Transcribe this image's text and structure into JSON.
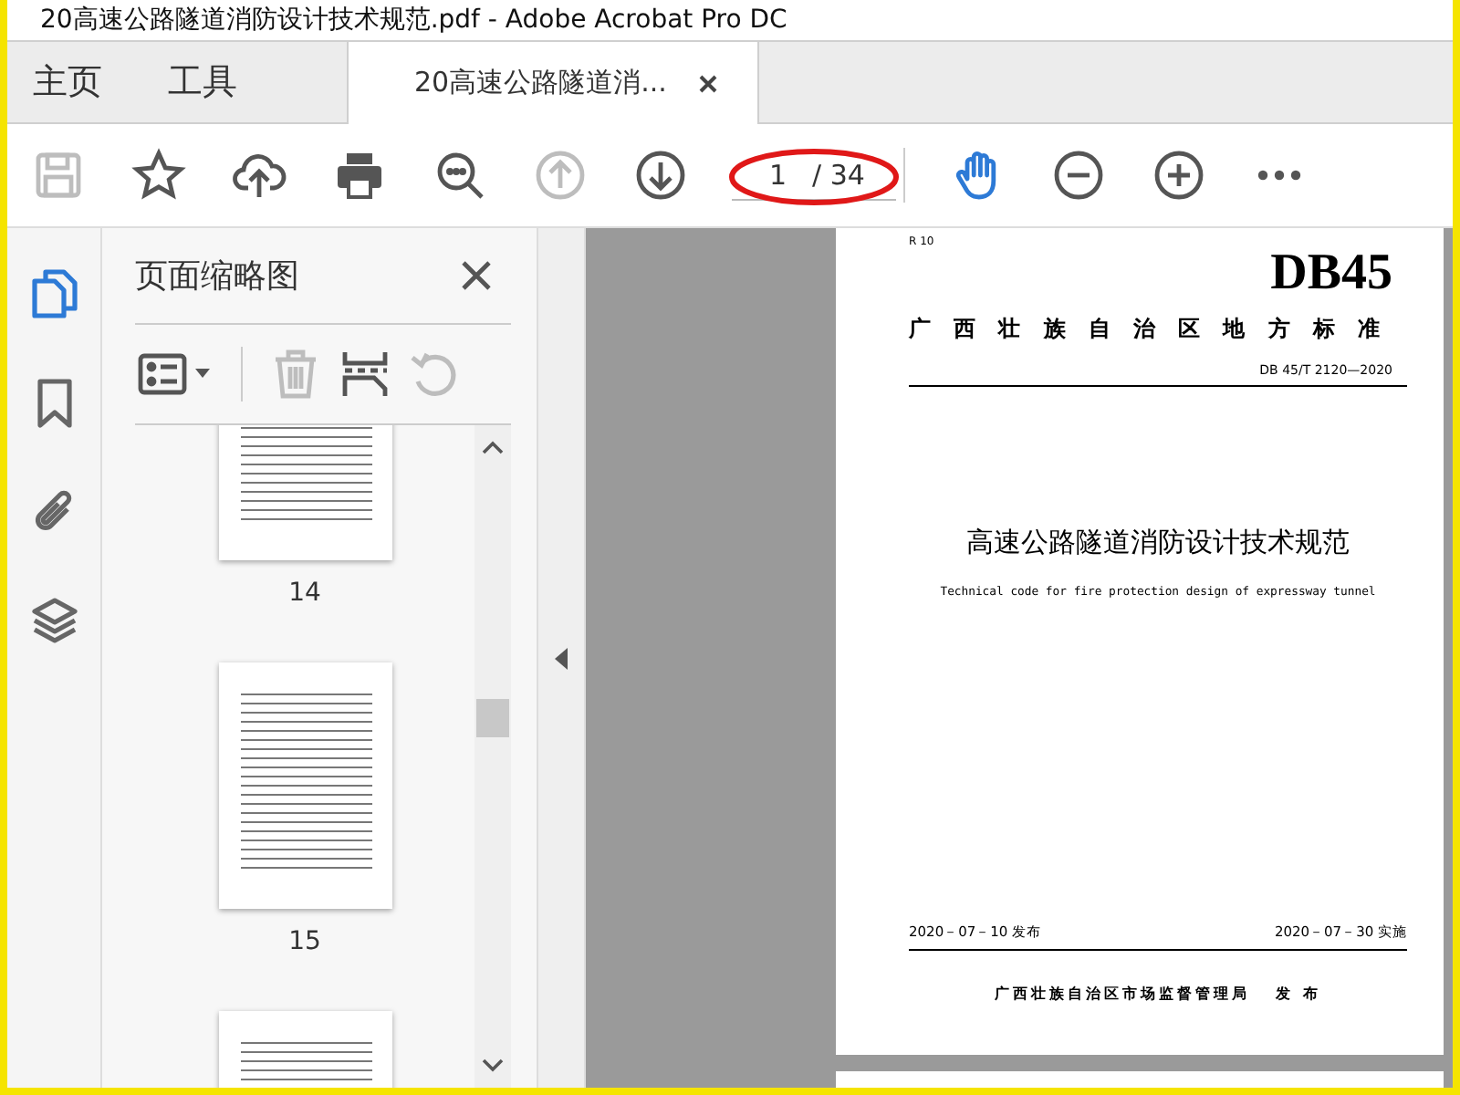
{
  "window": {
    "title": "20高速公路隧道消防设计技术规范.pdf - Adobe Acrobat Pro DC"
  },
  "tabs": [
    {
      "kind": "home",
      "label": "主页",
      "selected": false
    },
    {
      "kind": "tools",
      "label": "工具",
      "selected": false
    },
    {
      "kind": "document",
      "label": "20高速公路隧道消...",
      "selected": true
    }
  ],
  "toolbar": {
    "left_tools": [
      {
        "kind": "save",
        "disabled": true,
        "selected": false
      },
      {
        "kind": "star",
        "disabled": false,
        "selected": false
      },
      {
        "kind": "upload",
        "disabled": false,
        "selected": false
      },
      {
        "kind": "print",
        "disabled": false,
        "selected": false
      },
      {
        "kind": "zoom",
        "disabled": false,
        "selected": false
      },
      {
        "kind": "prev",
        "disabled": true,
        "selected": false
      },
      {
        "kind": "next",
        "disabled": false,
        "selected": false
      }
    ],
    "page_field": {
      "value": "1",
      "total": "/ 34"
    },
    "right_tools": [
      {
        "kind": "hand",
        "disabled": false,
        "selected": true
      },
      {
        "kind": "zoom_out",
        "disabled": false,
        "selected": false
      },
      {
        "kind": "zoom_in",
        "disabled": false,
        "selected": false
      },
      {
        "kind": "more",
        "disabled": false,
        "selected": false
      }
    ]
  },
  "side_rail": [
    {
      "kind": "pages",
      "selected": true
    },
    {
      "kind": "bookmarks",
      "selected": false
    },
    {
      "kind": "attachments",
      "selected": false
    },
    {
      "kind": "layers",
      "selected": false
    }
  ],
  "thumbnail_panel": {
    "title": "页面缩略图",
    "tools": [
      {
        "kind": "options",
        "disabled": false
      },
      {
        "kind": "delete",
        "disabled": true
      },
      {
        "kind": "insert",
        "disabled": false
      },
      {
        "kind": "rotate",
        "disabled": true
      }
    ],
    "thumbnails": [
      {
        "label": "14",
        "selected": false
      },
      {
        "label": "15",
        "selected": false
      },
      {
        "selected": false
      }
    ]
  },
  "document_page": {
    "code": "R 10",
    "logo": "DB45",
    "issuer": "广西壮族自治区地方标准",
    "number": "DB 45/T 2120—2020",
    "title": "高速公路隧道消防设计技术规范",
    "subtitle": "Technical code for fire protection design of expressway tunnel",
    "issue_date": "2020－07－10 发布",
    "effective_date": "2020－07－30 实施",
    "publisher": "广西壮族自治区市场监督管理局",
    "publish_word": "发 布"
  }
}
